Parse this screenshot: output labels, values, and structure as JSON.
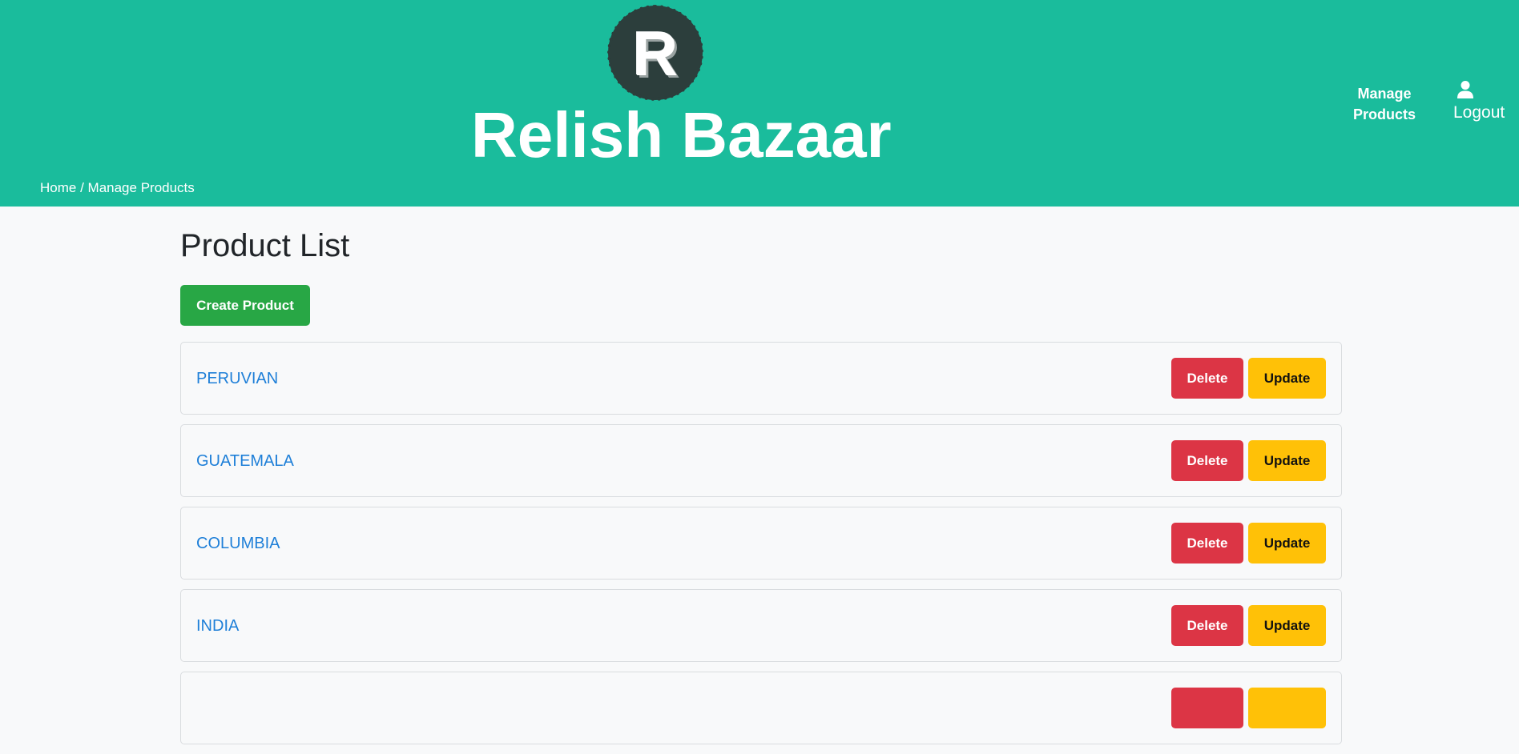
{
  "brand": {
    "logo_letter": "R",
    "title": "Relish Bazaar"
  },
  "nav": {
    "manage_products": "Manage Products",
    "logout": "Logout",
    "logout_icon": "user-icon"
  },
  "breadcrumb": {
    "home": "Home",
    "separator": " / ",
    "current": "Manage Products"
  },
  "main": {
    "title": "Product List",
    "create_button": "Create Product"
  },
  "products": [
    {
      "name": "PERUVIAN",
      "delete_label": "Delete",
      "update_label": "Update"
    },
    {
      "name": "GUATEMALA",
      "delete_label": "Delete",
      "update_label": "Update"
    },
    {
      "name": "COLUMBIA",
      "delete_label": "Delete",
      "update_label": "Update"
    },
    {
      "name": "INDIA",
      "delete_label": "Delete",
      "update_label": "Update"
    },
    {
      "name": "",
      "delete_label": "",
      "update_label": ""
    }
  ],
  "colors": {
    "header_bg": "#1abc9c",
    "page_bg": "#f8f9fa",
    "create": "#28a745",
    "delete": "#dc3545",
    "update": "#ffc107",
    "product_link": "#1e7fd8"
  }
}
